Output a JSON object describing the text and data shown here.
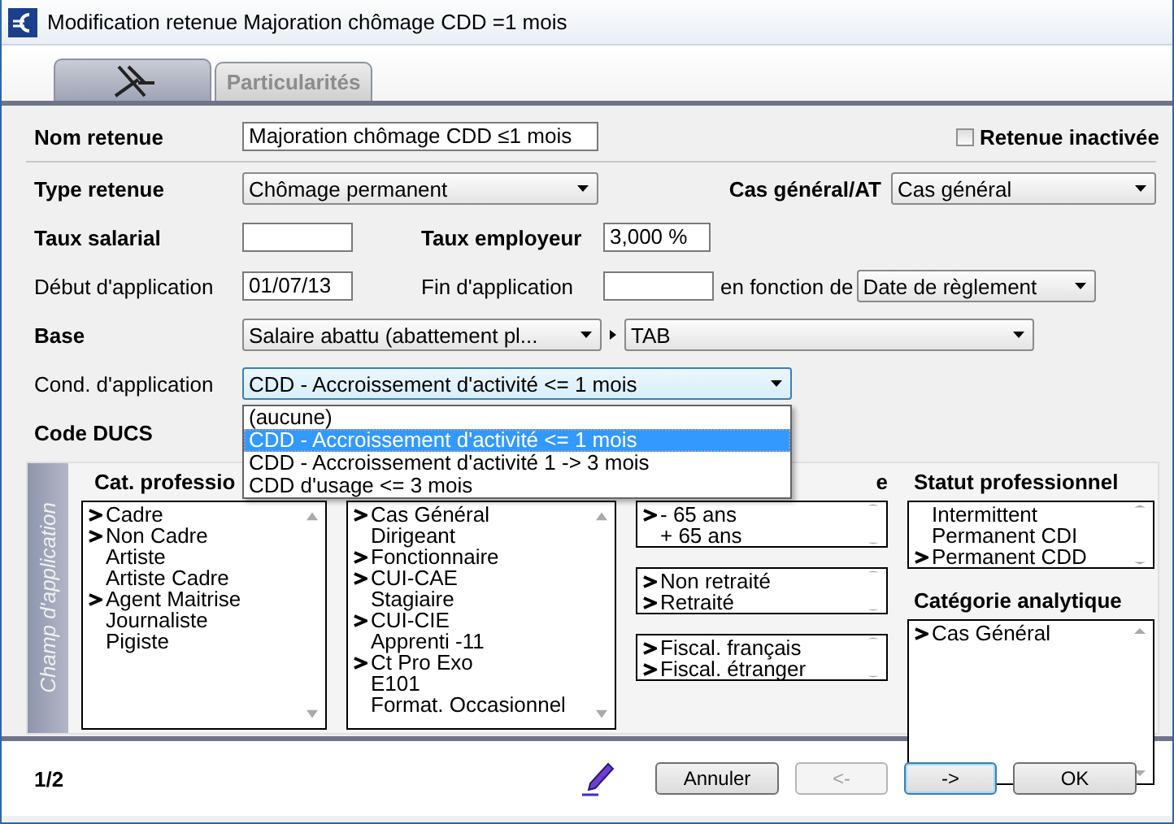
{
  "window": {
    "title": "Modification retenue Majoration chômage CDD =1 mois"
  },
  "tabs": [
    {
      "kind": "icon",
      "selected": true
    },
    {
      "kind": "text",
      "label": "Particularités",
      "selected": false
    }
  ],
  "nom_retenue": {
    "label": "Nom retenue",
    "value": "Majoration chômage CDD ≤1 mois"
  },
  "retenue_inactivee": {
    "label": "Retenue inactivée",
    "checked": false
  },
  "type_retenue": {
    "label": "Type retenue",
    "value": "Chômage permanent"
  },
  "cas_general_at": {
    "label": "Cas général/AT",
    "value": "Cas général"
  },
  "taux_salarial": {
    "label": "Taux salarial"
  },
  "taux_employeur": {
    "label": "Taux employeur",
    "value": "3,000 %"
  },
  "debut_application": {
    "label": "Début d'application",
    "value": "01/07/13"
  },
  "fin_application": {
    "label": "Fin d'application"
  },
  "en_fonction_de": {
    "label": "en fonction de",
    "value": "Date de règlement"
  },
  "base": {
    "label": "Base",
    "value": "Salaire abattu (abattement pl...",
    "sub_value": "TAB"
  },
  "cond_application": {
    "label": "Cond. d'application",
    "value": "CDD - Accroissement d'activité <= 1 mois",
    "expanded": true,
    "options": [
      {
        "label": "(aucune)",
        "selected": false
      },
      {
        "label": "CDD - Accroissement d'activité <= 1 mois",
        "selected": true
      },
      {
        "label": "CDD - Accroissement d'activité 1 -> 3 mois",
        "selected": false
      },
      {
        "label": "CDD d'usage <= 3 mois",
        "selected": false
      }
    ]
  },
  "code_ducs": {
    "label": "Code DUCS"
  },
  "champ_application": {
    "title": "Champ d'application",
    "columns": [
      {
        "lists": [
          {
            "header": "Cat. professio",
            "items": [
              {
                "label": "Cadre",
                "selected": true
              },
              {
                "label": "Non Cadre",
                "selected": true
              },
              {
                "label": "Artiste",
                "selected": false
              },
              {
                "label": "Artiste Cadre",
                "selected": false
              },
              {
                "label": "Agent Maitrise",
                "selected": true
              },
              {
                "label": "Journaliste",
                "selected": false
              },
              {
                "label": "Pigiste",
                "selected": false
              }
            ]
          }
        ]
      },
      {
        "lists": [
          {
            "items": [
              {
                "label": "Cas Général",
                "selected": true
              },
              {
                "label": "Dirigeant",
                "selected": false
              },
              {
                "label": "Fonctionnaire",
                "selected": true
              },
              {
                "label": "CUI-CAE",
                "selected": true
              },
              {
                "label": "Stagiaire",
                "selected": false
              },
              {
                "label": "CUI-CIE",
                "selected": true
              },
              {
                "label": "Apprenti -11",
                "selected": false
              },
              {
                "label": "Ct Pro Exo",
                "selected": true
              },
              {
                "label": "E101",
                "selected": false
              },
              {
                "label": "Format. Occasionnel",
                "selected": false
              }
            ]
          }
        ]
      },
      {
        "lists": [
          {
            "header": "e",
            "items": [
              {
                "label": "- 65 ans",
                "selected": true
              },
              {
                "label": "+ 65 ans",
                "selected": false
              }
            ]
          },
          {
            "items": [
              {
                "label": "Non retraité",
                "selected": true
              },
              {
                "label": "Retraité",
                "selected": true
              }
            ]
          },
          {
            "items": [
              {
                "label": "Fiscal. français",
                "selected": true
              },
              {
                "label": "Fiscal. étranger",
                "selected": true
              }
            ]
          }
        ]
      },
      {
        "lists": [
          {
            "header": "Statut professionnel",
            "items": [
              {
                "label": "Intermittent",
                "selected": false
              },
              {
                "label": "Permanent CDI",
                "selected": false
              },
              {
                "label": "Permanent CDD",
                "selected": true
              }
            ]
          },
          {
            "header": "Catégorie analytique",
            "items": [
              {
                "label": "Cas Général",
                "selected": true
              }
            ]
          }
        ]
      }
    ]
  },
  "footer": {
    "page": "1/2",
    "buttons": [
      {
        "label": "Annuler",
        "disabled": false,
        "focused": false
      },
      {
        "label": "<-",
        "disabled": true,
        "focused": false
      },
      {
        "label": "->",
        "disabled": false,
        "focused": true
      },
      {
        "label": "OK",
        "disabled": false,
        "focused": false
      }
    ]
  }
}
